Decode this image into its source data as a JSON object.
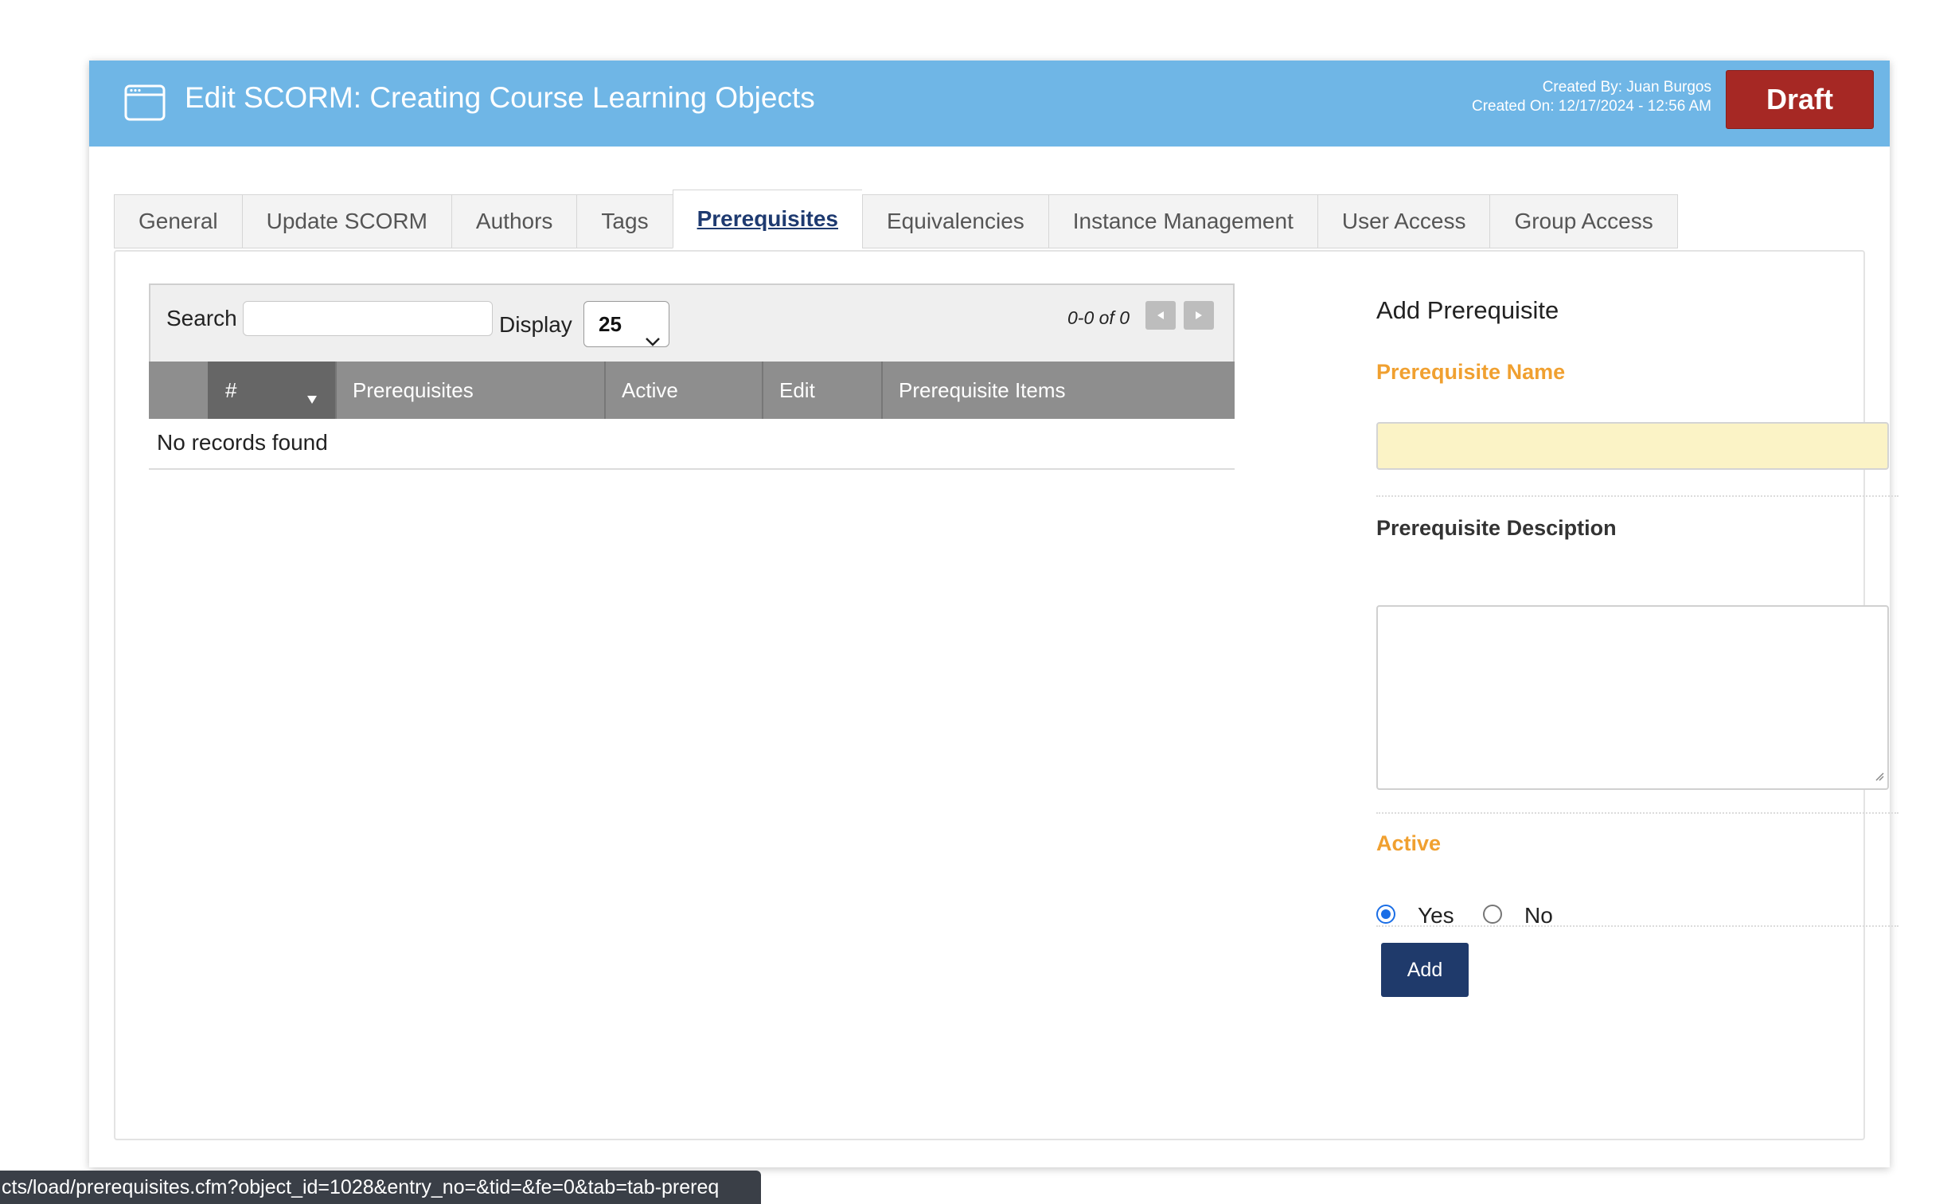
{
  "header": {
    "title": "Edit SCORM: Creating Course Learning Objects",
    "created_by": "Created By: Juan Burgos",
    "created_on": "Created On: 12/17/2024 - 12:56 AM",
    "status": "Draft",
    "icon": "window-icon"
  },
  "tabs": [
    {
      "label": "General"
    },
    {
      "label": "Update SCORM"
    },
    {
      "label": "Authors"
    },
    {
      "label": "Tags"
    },
    {
      "label": "Prerequisites",
      "active": true
    },
    {
      "label": "Equivalencies"
    },
    {
      "label": "Instance Management"
    },
    {
      "label": "User Access"
    },
    {
      "label": "Group Access"
    }
  ],
  "grid": {
    "search_label": "Search",
    "search_value": "",
    "display_label": "Display",
    "display_value": "25",
    "pager_text": "0-0 of 0",
    "columns": [
      "#",
      "Prerequisites",
      "Active",
      "Edit",
      "Prerequisite Items"
    ],
    "empty_text": "No records found"
  },
  "form": {
    "title": "Add Prerequisite",
    "name_label": "Prerequisite Name",
    "name_value": "",
    "description_label": "Prerequisite Desciption",
    "description_value": "",
    "active_label": "Active",
    "yes_label": "Yes",
    "no_label": "No",
    "active_selected": "Yes",
    "add_label": "Add"
  },
  "status_bar": {
    "url": "cts/load/prerequisites.cfm?object_id=1028&entry_no=&tid=&fe=0&tab=tab-prereq"
  },
  "colors": {
    "header_bg": "#6fb6e6",
    "draft_bg": "#a62824",
    "required_label": "#f0a030",
    "primary_button": "#1f3a6b"
  }
}
